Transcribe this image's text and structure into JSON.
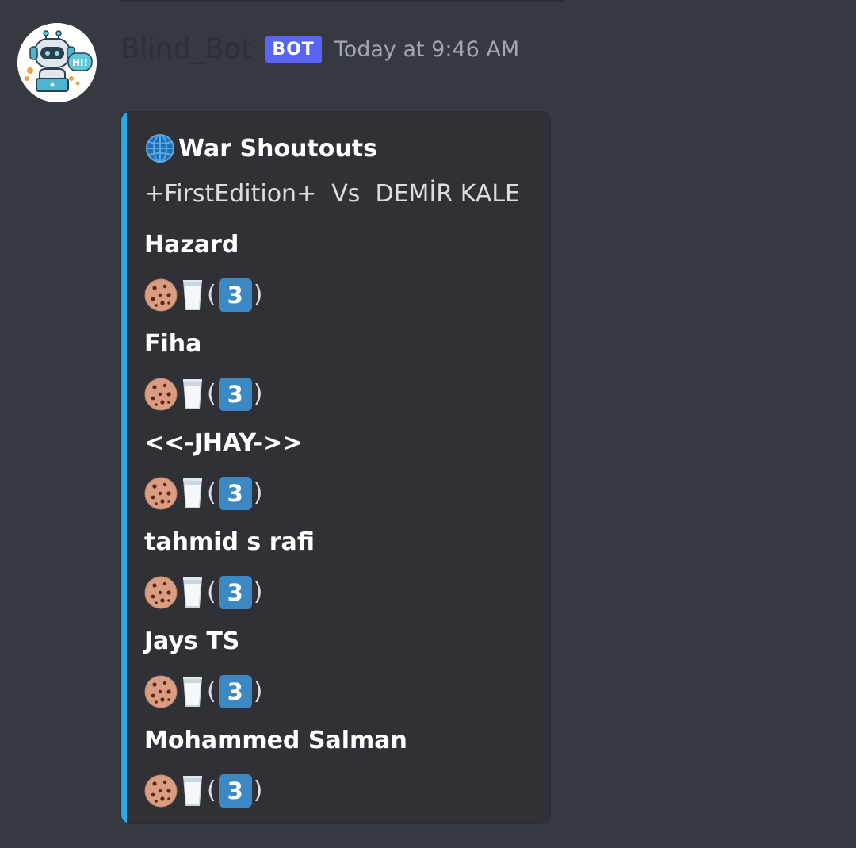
{
  "message": {
    "username": "Blind_Bot",
    "tag": "BOT",
    "timestamp": "Today at 9:46 AM",
    "avatar_icon": "robot-hi-icon"
  },
  "embed": {
    "accent_color": "#2ea8e6",
    "title_icon": "globe-icon",
    "title": "War Shoutouts",
    "description": "+FirstEdition+  Vs  DEMİR KALE",
    "entries": [
      {
        "name": "Hazard",
        "emoji_icons": [
          "cookie-icon",
          "milk-glass-icon"
        ],
        "paren_open": "(",
        "count": "3",
        "paren_close": ")"
      },
      {
        "name": "Fiha",
        "emoji_icons": [
          "cookie-icon",
          "milk-glass-icon"
        ],
        "paren_open": "(",
        "count": "3",
        "paren_close": ")"
      },
      {
        "name": "<<-JHAY->>",
        "emoji_icons": [
          "cookie-icon",
          "milk-glass-icon"
        ],
        "paren_open": "(",
        "count": "3",
        "paren_close": ")"
      },
      {
        "name": "tahmid s rafi",
        "emoji_icons": [
          "cookie-icon",
          "milk-glass-icon"
        ],
        "paren_open": "(",
        "count": "3",
        "paren_close": ")"
      },
      {
        "name": "Jays TS",
        "emoji_icons": [
          "cookie-icon",
          "milk-glass-icon"
        ],
        "paren_open": "(",
        "count": "3",
        "paren_close": ")"
      },
      {
        "name": "Mohammed Salman",
        "emoji_icons": [
          "cookie-icon",
          "milk-glass-icon"
        ],
        "paren_open": "(",
        "count": "3",
        "paren_close": ")"
      }
    ]
  },
  "colors": {
    "background": "#36393f",
    "embed_background": "#2f3136",
    "bot_tag": "#5865f2",
    "keycap": "#3b88c3"
  }
}
